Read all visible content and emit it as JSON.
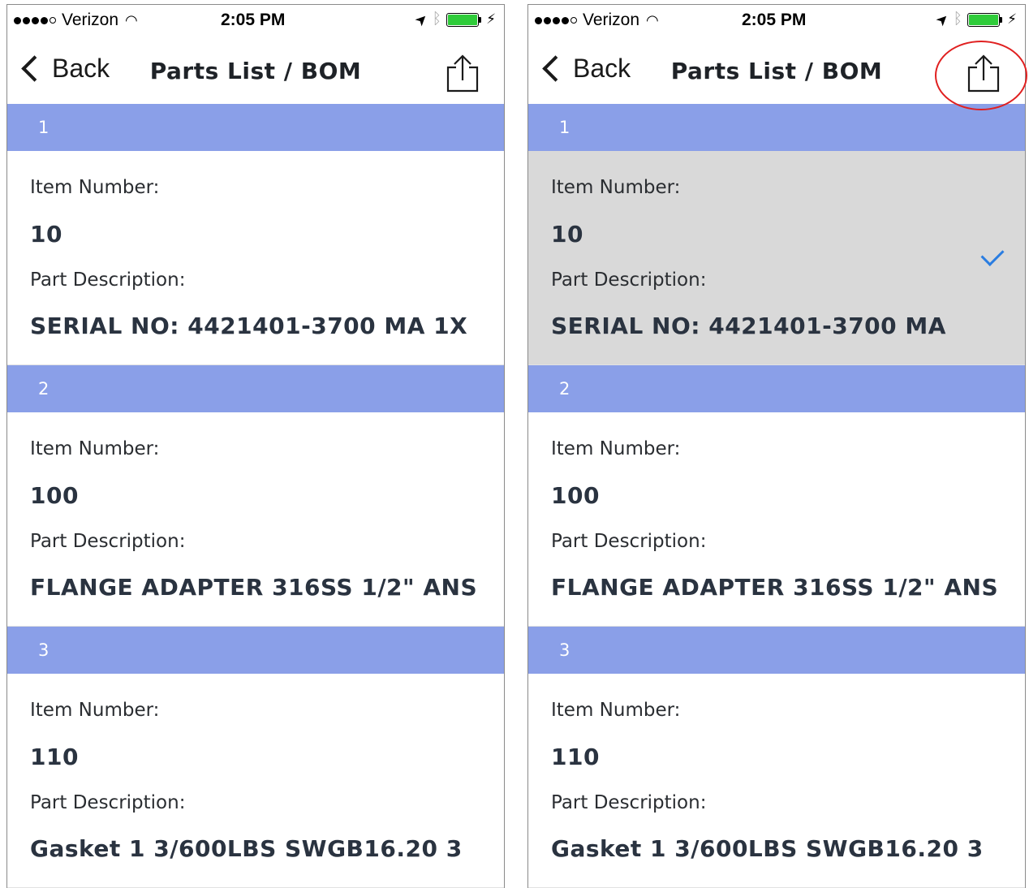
{
  "status_bar": {
    "carrier": "Verizon",
    "time": "2:05 PM"
  },
  "nav": {
    "back_label": "Back",
    "title": "Parts List / BOM"
  },
  "labels": {
    "item_number": "Item Number:",
    "part_description": "Part Description:"
  },
  "colors": {
    "section_header": "#8a9fe8",
    "selected_row": "#d9d9d9",
    "checkmark": "#2a7de1",
    "annotation_circle": "#e02020",
    "battery": "#2fcc3a"
  },
  "icons": [
    "signal-dots-icon",
    "wifi-icon",
    "location-arrow-icon",
    "bluetooth-icon",
    "battery-icon",
    "charging-bolt-icon",
    "chevron-left-icon",
    "share-icon",
    "checkmark-icon"
  ],
  "left_screen": {
    "items": [
      {
        "section": "1",
        "item_number": "10",
        "description": "SERIAL NO: 4421401-3700 MA 1X"
      },
      {
        "section": "2",
        "item_number": "100",
        "description": "FLANGE ADAPTER 316SS 1/2\" ANS"
      },
      {
        "section": "3",
        "item_number": "110",
        "description": "Gasket 1 3/600LBS SWGB16.20 3"
      }
    ]
  },
  "right_screen": {
    "selected_index": 0,
    "items": [
      {
        "section": "1",
        "item_number": "10",
        "description": "SERIAL NO: 4421401-3700 MA"
      },
      {
        "section": "2",
        "item_number": "100",
        "description": "FLANGE ADAPTER 316SS 1/2\" ANS"
      },
      {
        "section": "3",
        "item_number": "110",
        "description": "Gasket 1 3/600LBS SWGB16.20 3"
      }
    ]
  }
}
